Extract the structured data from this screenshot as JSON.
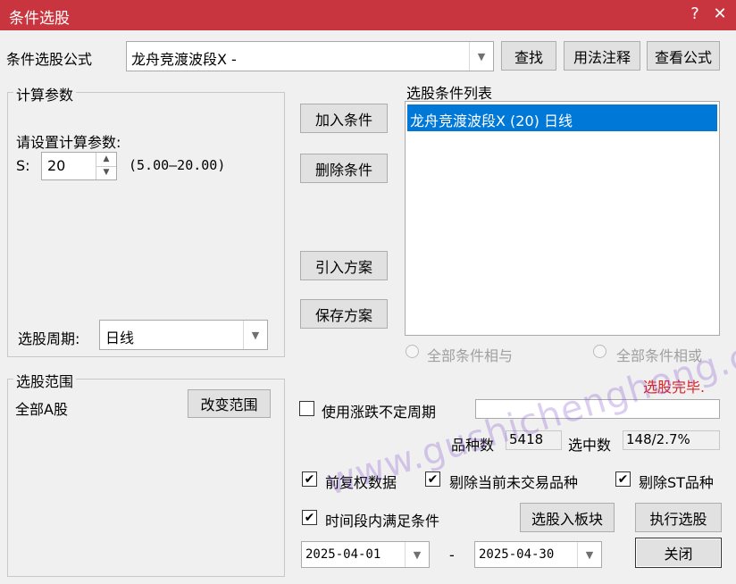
{
  "window": {
    "title": "条件选股",
    "help_glyph": "?",
    "close_glyph": "✕"
  },
  "formula": {
    "label": "条件选股公式",
    "value": "龙舟竞渡波段X  -",
    "find_button": "查找",
    "usage_button": "用法注释",
    "view_button": "查看公式"
  },
  "calc_params": {
    "group_title": "计算参数",
    "prompt": "请设置计算参数:",
    "param_label": "S:",
    "param_value": "20",
    "param_range": "(5.00—20.00)",
    "period_label": "选股周期:",
    "period_value": "日线"
  },
  "actions": {
    "add_condition": "加入条件",
    "delete_condition": "删除条件",
    "import_plan": "引入方案",
    "save_plan": "保存方案"
  },
  "conditions": {
    "title": "选股条件列表",
    "items": [
      "龙舟竞渡波段X (20) 日线"
    ],
    "and_label": "全部条件相与",
    "or_label": "全部条件相或"
  },
  "status": {
    "text": "选股完毕.",
    "color": "#e02020"
  },
  "scope": {
    "group_title": "选股范围",
    "value": "全部A股",
    "change_button": "改变范围"
  },
  "options": {
    "use_variable_period": "使用涨跌不定周期",
    "variable_period_checked": false,
    "forward_adjust": "前复权数据",
    "forward_adjust_checked": true,
    "exclude_untraded": "剔除当前未交易品种",
    "exclude_untraded_checked": true,
    "exclude_st": "剔除ST品种",
    "exclude_st_checked": true,
    "period_condition": "时间段内满足条件",
    "period_condition_checked": true
  },
  "stats": {
    "count_label": "品种数",
    "count_value": "5418",
    "selected_label": "选中数",
    "selected_value": "148/2.7%"
  },
  "dates": {
    "start": "2025-04-01",
    "separator": "-",
    "end": "2025-04-30"
  },
  "bottom": {
    "to_block_button": "选股入板块",
    "execute_button": "执行选股",
    "close_button": "关闭"
  },
  "watermark": "www.gushichenghong.com"
}
